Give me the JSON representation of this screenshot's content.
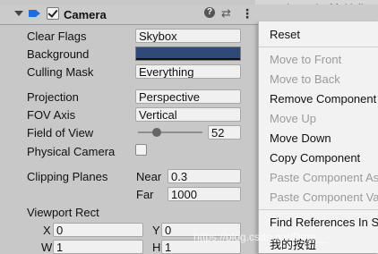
{
  "component": {
    "title": "Camera",
    "help_glyph": "?",
    "preset_glyph": "⇄",
    "menu_glyph": "⋮",
    "enabled": true
  },
  "top_strip": {
    "label": "Intensity Multiplie"
  },
  "properties": {
    "clear_flags": {
      "label": "Clear Flags",
      "value": "Skybox"
    },
    "background": {
      "label": "Background",
      "color": "#2f4a78"
    },
    "culling_mask": {
      "label": "Culling Mask",
      "value": "Everything"
    },
    "projection": {
      "label": "Projection",
      "value": "Perspective"
    },
    "fov_axis": {
      "label": "FOV Axis",
      "value": "Vertical"
    },
    "field_of_view": {
      "label": "Field of View",
      "value": "52"
    },
    "physical_camera": {
      "label": "Physical Camera",
      "checked": false
    },
    "clipping_planes": {
      "label": "Clipping Planes",
      "near_label": "Near",
      "near": "0.3",
      "far_label": "Far",
      "far": "1000"
    },
    "viewport_rect": {
      "label": "Viewport Rect",
      "x_label": "X",
      "x": "0",
      "y_label": "Y",
      "y": "0",
      "w_label": "W",
      "w": "1",
      "h_label": "H",
      "h": "1"
    }
  },
  "context_menu": {
    "items": [
      {
        "label": "Reset",
        "enabled": true
      },
      {
        "label": "Move to Front",
        "enabled": false
      },
      {
        "label": "Move to Back",
        "enabled": false
      },
      {
        "label": "Remove Component",
        "enabled": true
      },
      {
        "label": "Move Up",
        "enabled": false
      },
      {
        "label": "Move Down",
        "enabled": true
      },
      {
        "label": "Copy Component",
        "enabled": true
      },
      {
        "label": "Paste Component As",
        "enabled": false
      },
      {
        "label": "Paste Component Va",
        "enabled": false
      },
      {
        "label": "Find References In Sc",
        "enabled": true
      },
      {
        "label": "我的按钮",
        "enabled": true
      }
    ]
  },
  "watermark": "https://blog.csdn.net/Dore__"
}
